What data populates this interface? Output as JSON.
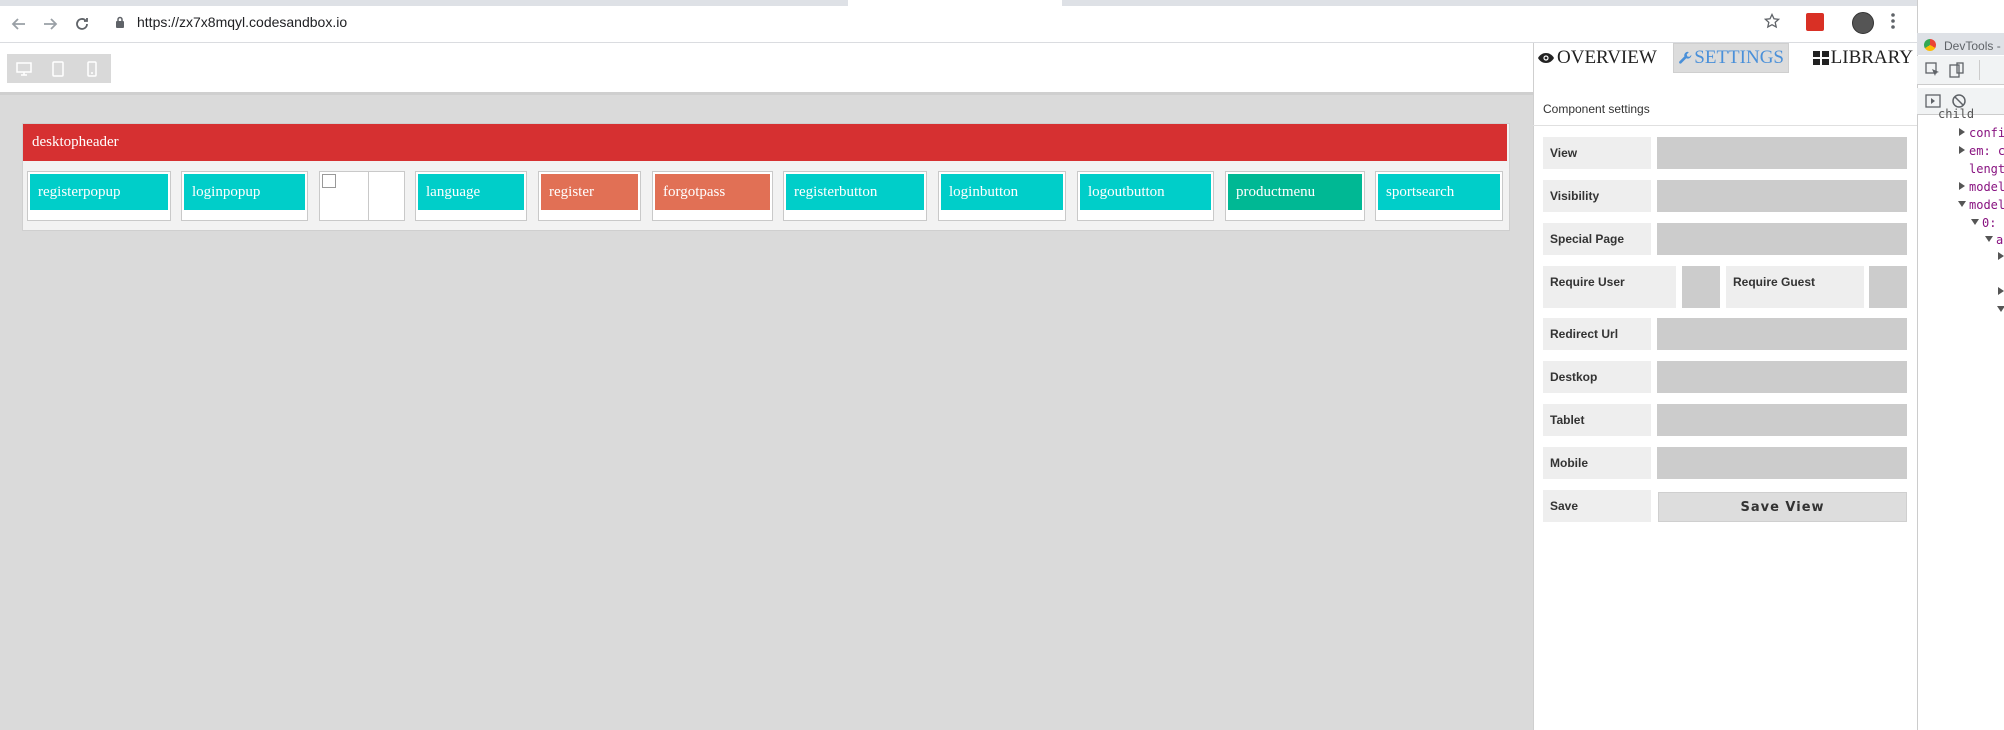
{
  "browser": {
    "url": "https://zx7x8mqyl.codesandbox.io"
  },
  "devices": [
    "desktop-icon",
    "tablet-icon",
    "mobile-icon"
  ],
  "canvas": {
    "header_label": "desktopheader",
    "components": [
      {
        "label": "registerpopup",
        "color": "#00cec9"
      },
      {
        "label": "loginpopup",
        "color": "#00cec9"
      },
      {
        "label": "",
        "color": "#ffffff",
        "broken_image": true
      },
      {
        "label": "language",
        "color": "#00cec9"
      },
      {
        "label": "register",
        "color": "#e17055"
      },
      {
        "label": "forgotpass",
        "color": "#e17055"
      },
      {
        "label": "registerbutton",
        "color": "#00cec9"
      },
      {
        "label": "loginbutton",
        "color": "#00cec9"
      },
      {
        "label": "logoutbutton",
        "color": "#00cec9"
      },
      {
        "label": "productmenu",
        "color": "#00b894"
      },
      {
        "label": "sportsearch",
        "color": "#00cec9"
      }
    ]
  },
  "panel": {
    "tabs": [
      {
        "label": "OVERVIEW",
        "icon": "eye-icon"
      },
      {
        "label": "SETTINGS",
        "icon": "wrench-icon",
        "active": true
      },
      {
        "label": "LIBRARY",
        "icon": "grid-icon"
      }
    ],
    "title": "Component settings",
    "fields": {
      "view": "View",
      "visibility": "Visibility",
      "special_page": "Special Page",
      "require_user": "Require User",
      "require_guest": "Require Guest",
      "redirect_url": "Redirect Url",
      "desktop": "Destkop",
      "tablet": "Tablet",
      "mobile": "Mobile",
      "save": "Save"
    },
    "save_button": "Save View"
  },
  "devtools": {
    "title": "DevTools -",
    "lines": [
      "child",
      "confi",
      "em: c",
      "lengt",
      "model",
      "model",
      "0:",
      "a"
    ]
  }
}
